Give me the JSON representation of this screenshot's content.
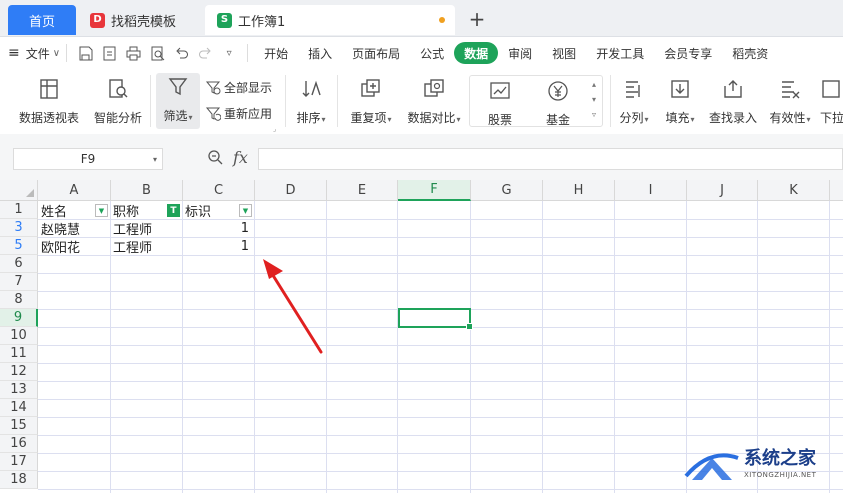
{
  "tabs": {
    "home": "首页",
    "template": "找稻壳模板",
    "workbook": "工作簿1",
    "new_tab": "+"
  },
  "menubar": {
    "hamburger": "≡",
    "file": "文件",
    "items": [
      "开始",
      "插入",
      "页面布局",
      "公式",
      "数据",
      "审阅",
      "视图",
      "开发工具",
      "会员专享",
      "稻壳资"
    ],
    "active": "数据"
  },
  "ribbon": {
    "pivot": "数据透视表",
    "smart_analysis": "智能分析",
    "filter": "筛选",
    "show_all": "全部显示",
    "reapply": "重新应用",
    "sort": "排序",
    "duplicates": "重复项",
    "compare": "数据对比",
    "stocks": "股票",
    "funds": "基金",
    "split": "分列",
    "fill": "填充",
    "lookup_entry": "查找录入",
    "validity": "有效性",
    "dropdown": "下拉"
  },
  "formula_bar": {
    "name_box": "F9",
    "fx": "fx",
    "value": ""
  },
  "sheet": {
    "columns": [
      "A",
      "B",
      "C",
      "D",
      "E",
      "F",
      "G",
      "H",
      "I",
      "J",
      "K"
    ],
    "selected_column": "F",
    "selected_cell": "F9",
    "rows": [
      "1",
      "3",
      "5",
      "6",
      "7",
      "8",
      "9",
      "10",
      "11",
      "12",
      "13",
      "14",
      "15",
      "16",
      "17",
      "18"
    ],
    "filtered_rows": [
      "3",
      "5"
    ],
    "header_row": {
      "a": "姓名",
      "b": "职称",
      "c": "标识"
    },
    "row3": {
      "a": "赵晓慧",
      "b": "工程师",
      "c": "1"
    },
    "row5": {
      "a": "欧阳花",
      "b": "工程师",
      "c": "1"
    }
  },
  "watermark": {
    "title": "系统之家",
    "url": "XITONGZHIJIA.NET"
  },
  "colors": {
    "accent_green": "#1ea35a",
    "home_tab_blue": "#2f7df6",
    "arrow_red": "#e02020"
  }
}
